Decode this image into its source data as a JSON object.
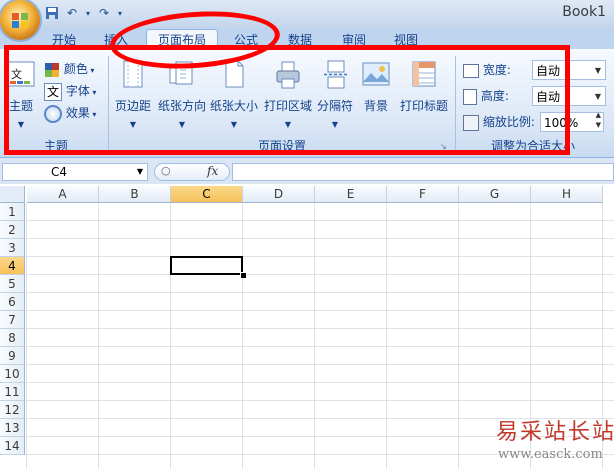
{
  "window": {
    "book_title": "Book1"
  },
  "tabs": [
    {
      "label": "开始"
    },
    {
      "label": "插入"
    },
    {
      "label": "页面布局"
    },
    {
      "label": "公式"
    },
    {
      "label": "数据"
    },
    {
      "label": "审阅"
    },
    {
      "label": "视图"
    }
  ],
  "ribbon": {
    "theme_group": {
      "label": "主题",
      "theme_button": "主题",
      "colors": "颜色",
      "fonts": "字体",
      "effects": "效果"
    },
    "page_setup_group": {
      "label": "页面设置",
      "buttons": [
        "页边距",
        "纸张方向",
        "纸张大小",
        "打印区域",
        "分隔符",
        "背景",
        "打印标题"
      ]
    },
    "scale_group": {
      "label": "调整为合适大小",
      "width_label": "宽度:",
      "width_value": "自动",
      "height_label": "高度:",
      "height_value": "自动",
      "scale_label": "缩放比例:",
      "scale_value": "100%"
    }
  },
  "formula_bar": {
    "name_box": "C4",
    "fx": "fx",
    "formula": ""
  },
  "grid": {
    "columns": [
      "A",
      "B",
      "C",
      "D",
      "E",
      "F",
      "G",
      "H"
    ],
    "rows": [
      "1",
      "2",
      "3",
      "4",
      "5",
      "6",
      "7",
      "8",
      "9",
      "10",
      "11",
      "12",
      "13",
      "14"
    ],
    "active_cell": "C4",
    "active_col": "C",
    "active_row": "4"
  },
  "watermark": {
    "site_name": "易采站长站",
    "url": "www.easck.com"
  },
  "colors": {
    "annotation": "#ff0000",
    "selected_header": "#f6c15b",
    "ribbon_text": "#15428b"
  }
}
